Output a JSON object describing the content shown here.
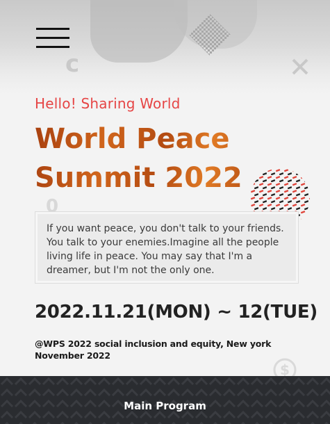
{
  "header": {
    "menu_icon": "hamburger-menu-icon"
  },
  "hero": {
    "kicker": "Hello! Sharing World",
    "title_line1": "World Peace",
    "title_line2": "Summit 2022",
    "quote": "If you want peace, you don't talk to your friends. You talk to your enemies.Imagine all the people living life in peace. You may say that I'm a dreamer, but I'm not the only one.",
    "date": "2022.11.21(MON) ~ 12(TUE)",
    "venue": "@WPS 2022 social inclusion and equity, New york November 2022"
  },
  "footer": {
    "main_program_label": "Main Program"
  },
  "colors": {
    "kicker": "#e64545",
    "title": "#c25315",
    "bottom_bar": "#2a2c30",
    "dot_red": "#e0443a",
    "dot_dark": "#222222"
  }
}
